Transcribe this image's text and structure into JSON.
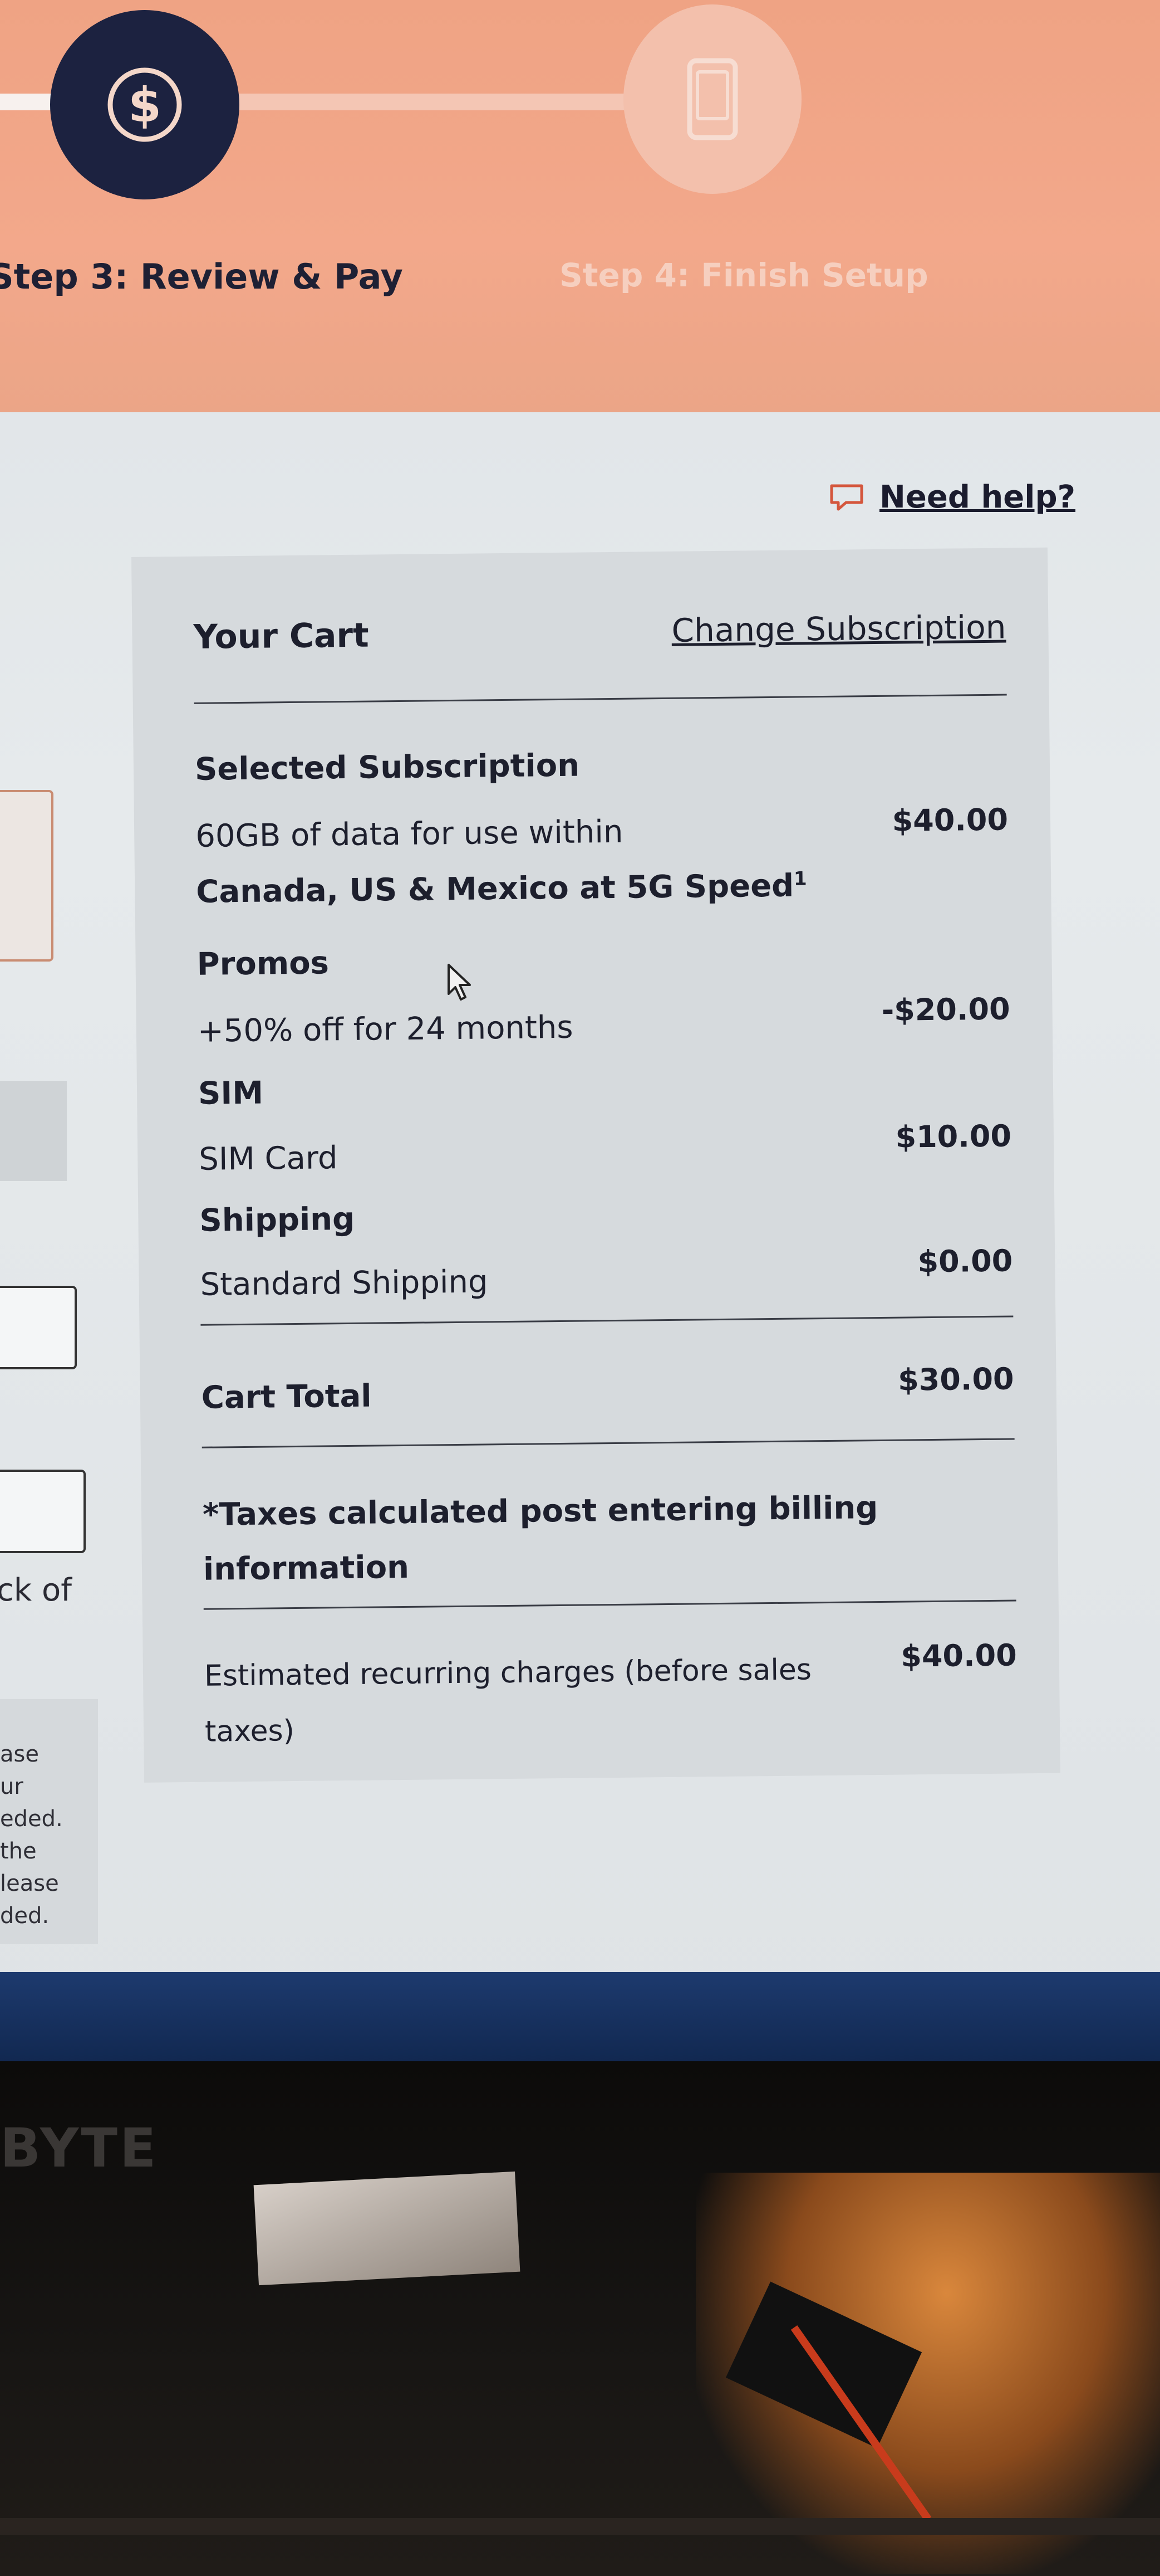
{
  "steps": {
    "step3_label": "Step 3: Review & Pay",
    "step4_label": "Step 4: Finish Setup",
    "step3_icon": "dollar-icon",
    "step4_icon": "phone-icon"
  },
  "help": {
    "icon": "chat-icon",
    "label": "Need help?"
  },
  "cart": {
    "title": "Your Cart",
    "change_link": "Change Subscription",
    "subscription_heading": "Selected Subscription",
    "subscription_line1": "60GB of data for use within",
    "subscription_line2": "Canada, US & Mexico at 5G Speed",
    "subscription_footnote": "1",
    "subscription_price": "$40.00",
    "promos_heading": "Promos",
    "promo_label": "+50% off for 24 months",
    "promo_price": "-$20.00",
    "sim_heading": "SIM",
    "sim_label": "SIM Card",
    "sim_price": "$10.00",
    "shipping_heading": "Shipping",
    "shipping_label": "Standard Shipping",
    "shipping_price": "$0.00",
    "total_label": "Cart Total",
    "total_price": "$30.00",
    "tax_line1": "*Taxes calculated post entering billing",
    "tax_line2": "information",
    "recurring_line1": "Estimated recurring charges (before sales",
    "recurring_line2": "taxes)",
    "recurring_price": "$40.00"
  },
  "left_fragments": {
    "lack_text": "ck of",
    "note_lines": [
      "ase",
      "ur",
      "eded.",
      " the",
      "lease",
      "ded."
    ]
  },
  "monitor_brand": "BYTE",
  "colors": {
    "header": "#f3a88b",
    "active_step": "#1c2240",
    "panel": "#d6dadd"
  }
}
